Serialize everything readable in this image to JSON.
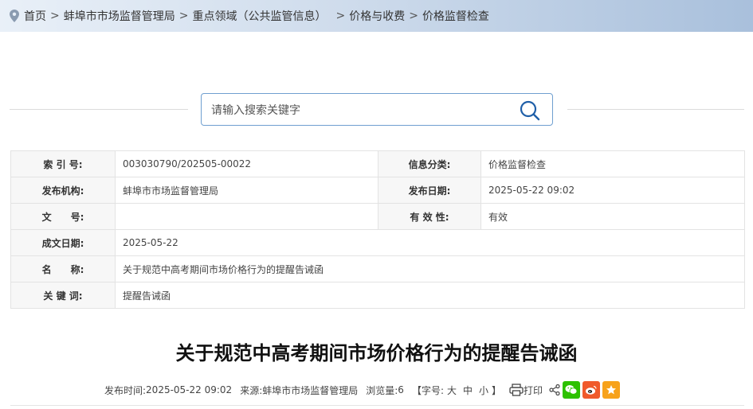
{
  "breadcrumb": {
    "items": [
      {
        "label": "首页"
      },
      {
        "label": "蚌埠市市场监督管理局"
      },
      {
        "label": "重点领域（公共监管信息）"
      },
      {
        "label": "价格与收费"
      },
      {
        "label": "价格监督检查"
      }
    ],
    "sep": ">"
  },
  "search": {
    "placeholder": "请输入搜索关键字",
    "value": ""
  },
  "meta": {
    "index_label": "索 引 号:",
    "index_value": "003030790/202505-00022",
    "category_label": "信息分类:",
    "category_value": "价格监督检查",
    "publisher_label": "发布机构:",
    "publisher_value": "蚌埠市市场监督管理局",
    "pubdate_label": "发布日期:",
    "pubdate_value": "2025-05-22 09:02",
    "docno_label": "文　　号:",
    "docno_value": "",
    "validity_label": "有 效 性:",
    "validity_value": "有效",
    "created_label": "成文日期:",
    "created_value": "2025-05-22",
    "name_label": "名　　称:",
    "name_value": "关于规范中高考期间市场价格行为的提醒告诫函",
    "keywords_label": "关 键 词:",
    "keywords_value": "提醒告诫函"
  },
  "article": {
    "title": "关于规范中高考期间市场价格行为的提醒告诫函",
    "pub_time_label": "发布时间:",
    "pub_time": "2025-05-22 09:02",
    "source_label": "来源:",
    "source": "蚌埠市市场监督管理局",
    "views_label": "浏览量:",
    "views": "6",
    "fontsize_open": "【字号:",
    "fontsize_large": "大",
    "fontsize_medium": "中",
    "fontsize_small": "小",
    "fontsize_close": "】",
    "print_label": "打印"
  },
  "colors": {
    "wechat": "#2dc100",
    "weibo": "#f05a2b",
    "favorite": "#f7a21b",
    "search_border": "#6f9fd0"
  }
}
